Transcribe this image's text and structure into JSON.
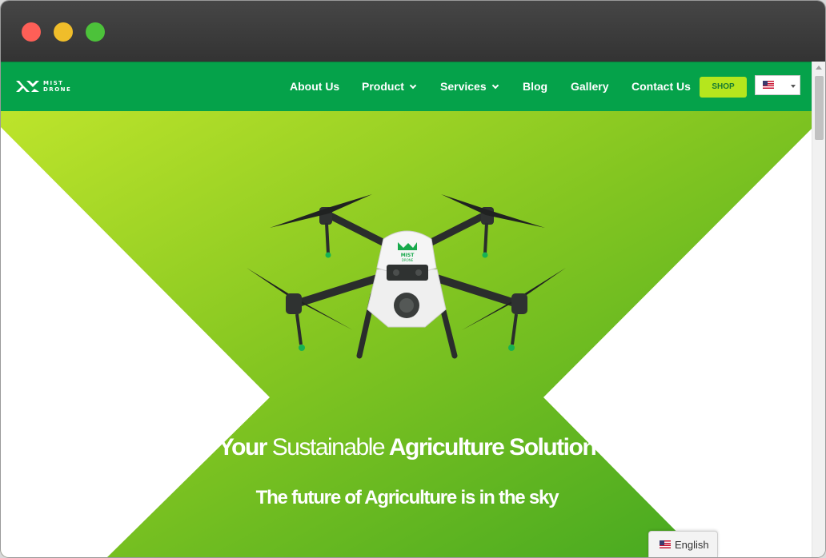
{
  "window": {
    "controls": [
      "close",
      "minimize",
      "maximize"
    ]
  },
  "navbar": {
    "logo_line1": "MIST",
    "logo_line2": "DRONE",
    "items": [
      {
        "label": "About Us"
      },
      {
        "label": "Product",
        "has_dropdown": true
      },
      {
        "label": "Services",
        "has_dropdown": true
      },
      {
        "label": "Blog"
      },
      {
        "label": "Gallery"
      },
      {
        "label": "Contact Us"
      }
    ],
    "shop_label": "SHOP",
    "language_flag": "us-flag-icon"
  },
  "hero": {
    "title_part1": "Your",
    "title_part2": "Sustainable",
    "title_part3": "Agriculture Solution",
    "subtitle": "The future of Agriculture is in the sky",
    "drone_badge_line1": "MIST",
    "drone_badge_line2": "DRONE"
  },
  "language_switcher": {
    "label": "English",
    "flag": "us-flag-icon"
  },
  "colors": {
    "nav_green": "#05a24a",
    "hero_green_light": "#b7e12a",
    "hero_green_dark": "#3fa71f",
    "shop_button": "#b5e61d"
  }
}
